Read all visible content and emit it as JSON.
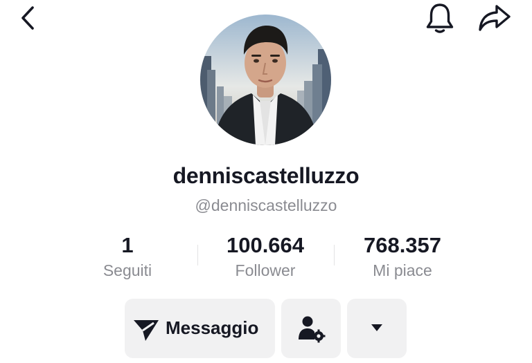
{
  "header": {
    "back_icon": "chevron-left-icon",
    "notification_icon": "bell-icon",
    "share_icon": "share-arrow-icon"
  },
  "profile": {
    "display_name": "denniscastelluzzo",
    "handle": "@denniscastelluzzo"
  },
  "stats": {
    "following": {
      "value": "1",
      "label": "Seguiti"
    },
    "followers": {
      "value": "100.664",
      "label": "Follower"
    },
    "likes": {
      "value": "768.357",
      "label": "Mi piace"
    }
  },
  "actions": {
    "message_label": "Messaggio",
    "message_icon": "paper-plane-icon",
    "friends_icon": "person-settings-icon",
    "more_icon": "caret-down-icon"
  },
  "colors": {
    "text_primary": "#161823",
    "text_secondary": "#8a8b91",
    "button_bg": "#f1f1f2"
  }
}
